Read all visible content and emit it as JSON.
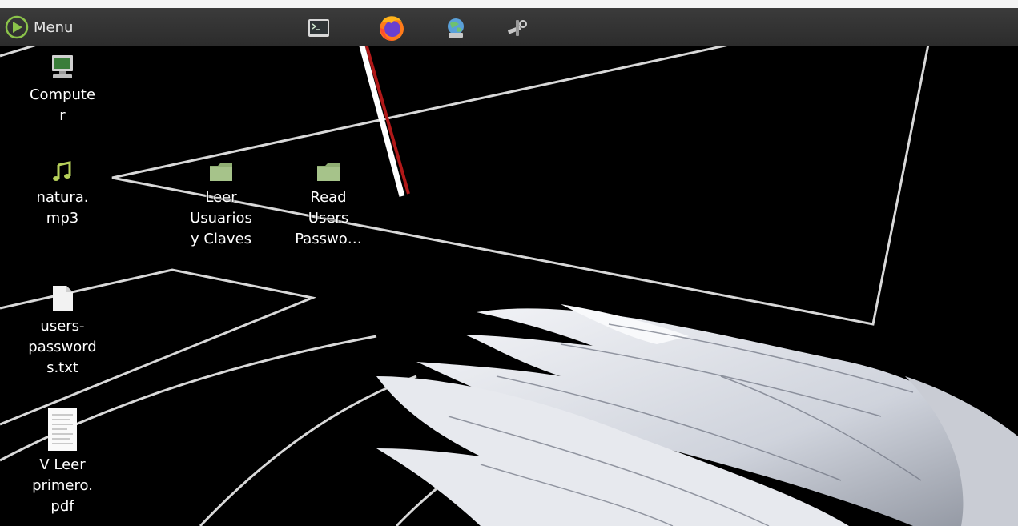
{
  "panel": {
    "menu_label": "Menu",
    "launchers": [
      {
        "name": "terminal",
        "icon": "terminal-icon"
      },
      {
        "name": "firefox",
        "icon": "firefox-icon"
      },
      {
        "name": "network",
        "icon": "network-icon"
      },
      {
        "name": "tools",
        "icon": "tools-icon"
      }
    ]
  },
  "desktop": {
    "computer": {
      "label": "Compute\nr",
      "icon": "computer-icon"
    },
    "natura": {
      "label": "natura.\nmp3",
      "icon": "music-note-icon"
    },
    "leer": {
      "label": "Leer\nUsuarios\ny Claves",
      "icon": "folder-icon"
    },
    "read": {
      "label": "Read\nUsers\nPasswo…",
      "icon": "folder-icon"
    },
    "users": {
      "label": "users-\npassword\ns.txt",
      "icon": "text-file-icon"
    },
    "leerpdf": {
      "label": "V Leer\nprimero.\npdf",
      "icon": "pdf-file-icon"
    }
  },
  "colors": {
    "panel": "#333333",
    "folder": "#a6c38a",
    "music": "#b6d05a",
    "arrow_red": "#b01818"
  }
}
